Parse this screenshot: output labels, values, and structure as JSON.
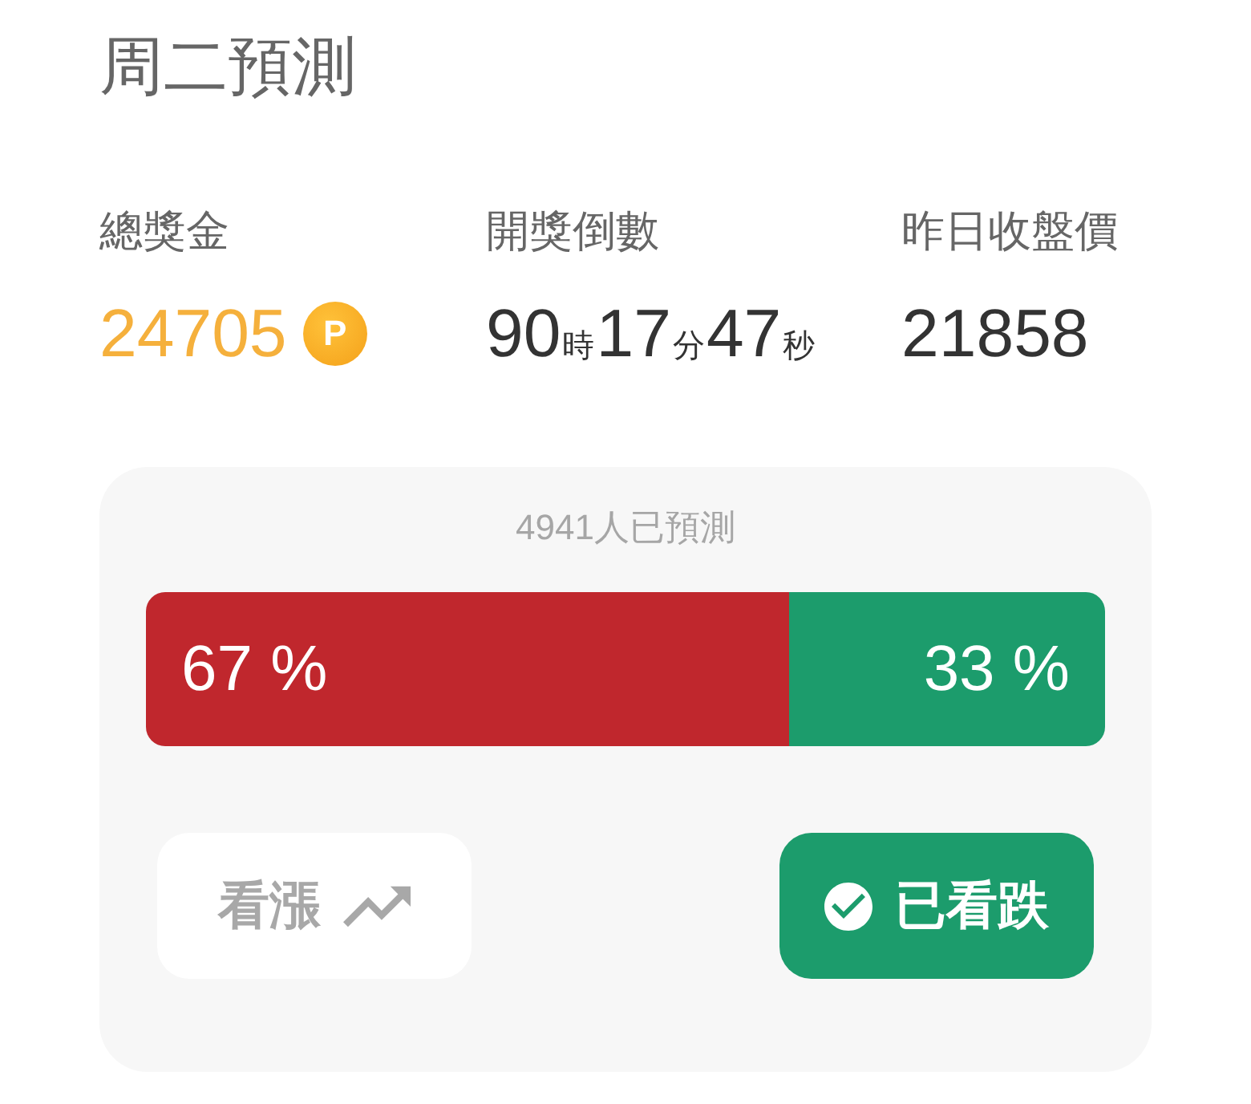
{
  "title": "周二預測",
  "stats": [
    {
      "kind": "prize",
      "label": "總獎金",
      "value": "24705",
      "badge": "P"
    },
    {
      "kind": "countdown",
      "label": "開獎倒數",
      "parts": [
        {
          "number": "90",
          "unit": "時"
        },
        {
          "number": "17",
          "unit": "分"
        },
        {
          "number": "47",
          "unit": "秒"
        }
      ]
    },
    {
      "kind": "price",
      "label": "昨日收盤價",
      "value": "21858"
    }
  ],
  "poll": {
    "count_text": "4941人已預測",
    "segments": [
      {
        "label": "67 %",
        "level": 0.67,
        "color": "#c0272d"
      },
      {
        "label": "33 %",
        "level": 0.33,
        "color": "#1c9c6c"
      }
    ],
    "buttons": [
      {
        "label": "看漲",
        "kind": "up",
        "selected": false
      },
      {
        "label": "已看跌",
        "kind": "down",
        "selected": true
      }
    ]
  }
}
